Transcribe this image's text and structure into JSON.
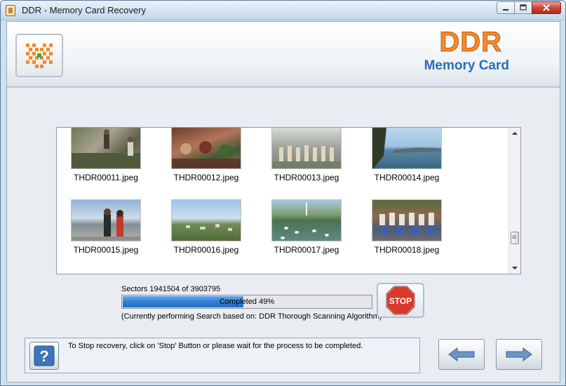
{
  "window": {
    "title": "DDR - Memory Card Recovery",
    "controls": [
      "minimize",
      "maximize",
      "close"
    ]
  },
  "header": {
    "brand_title": "DDR",
    "brand_subtitle": "Memory Card",
    "logo_icon": "ddr-logo-icon"
  },
  "gallery": {
    "files": [
      "THDR00011.jpeg",
      "THDR00012.jpeg",
      "THDR00013.jpeg",
      "THDR00014.jpeg",
      "THDR00015.jpeg",
      "THDR00016.jpeg",
      "THDR00017.jpeg",
      "THDR00018.jpeg"
    ]
  },
  "progress": {
    "sectors_text": "Sectors  1941504 of 3903795",
    "percent": 49,
    "label": "Completed 49%",
    "algorithm_text": "(Currently performing Search based on:  DDR Thorough Scanning Algorithm)"
  },
  "stop_button": {
    "label": "STOP"
  },
  "help": {
    "button_label": "?",
    "message": "To Stop recovery, click on 'Stop' Button or please wait for the process to be completed."
  },
  "colors": {
    "brand_orange": "#f28a2e",
    "brand_blue": "#2a6fb6",
    "progress_blue": "#2f7fd8",
    "stop_red": "#d8392a"
  }
}
